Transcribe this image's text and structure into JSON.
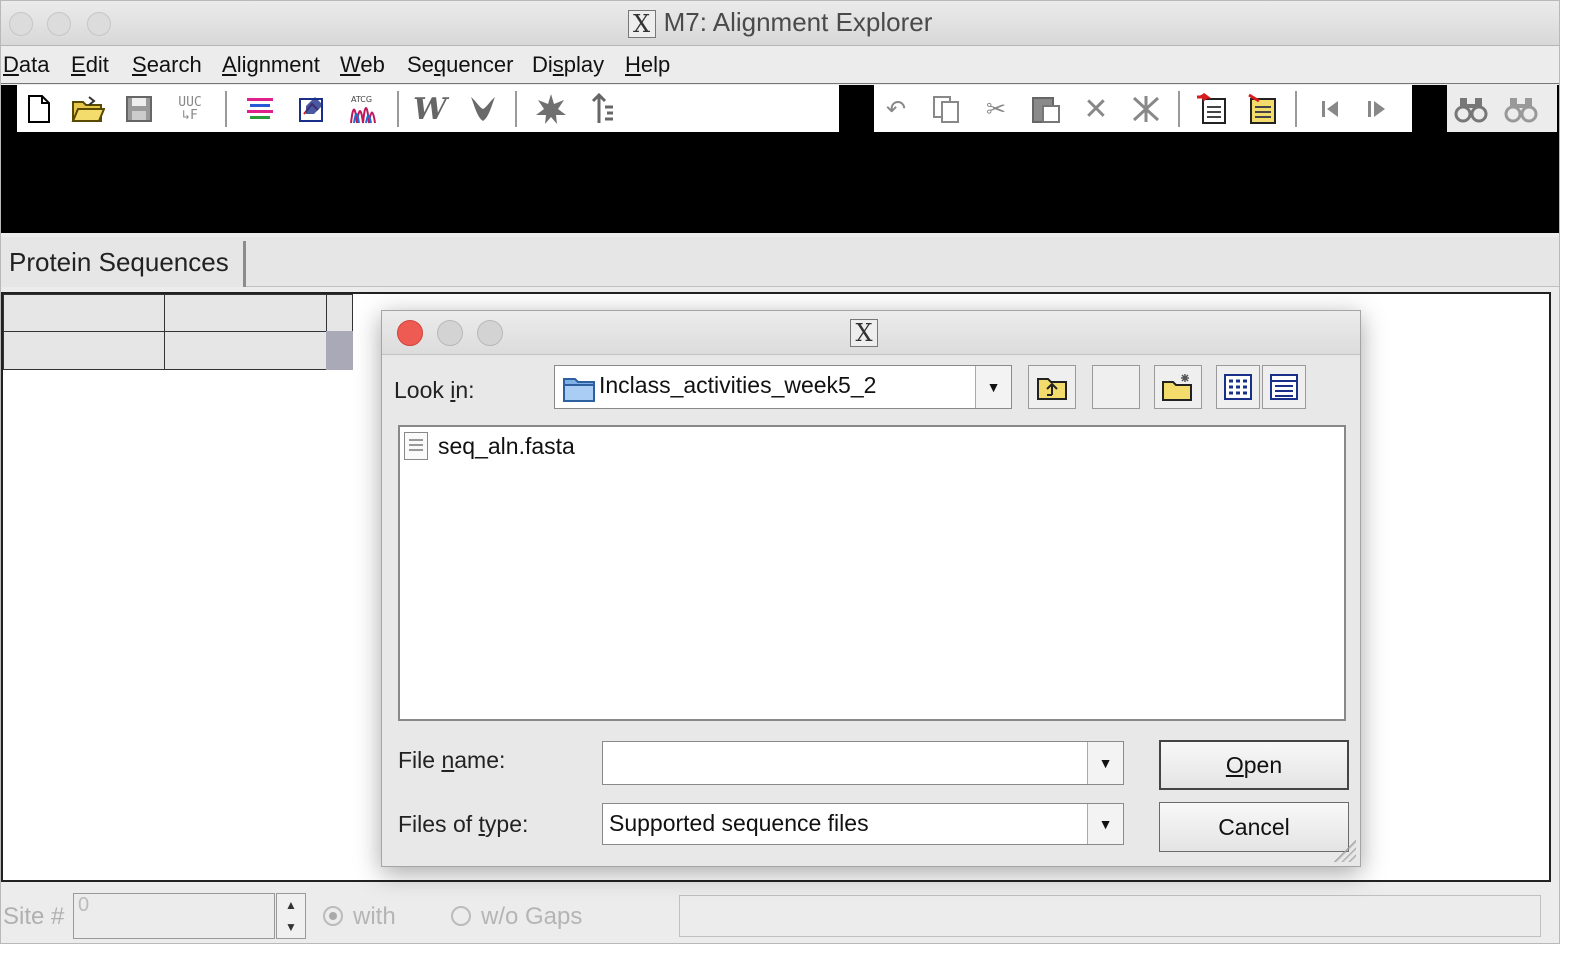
{
  "window": {
    "title": "M7: Alignment Explorer"
  },
  "menu": {
    "items": [
      {
        "pre": "",
        "u": "D",
        "post": "ata"
      },
      {
        "pre": "",
        "u": "E",
        "post": "dit"
      },
      {
        "pre": "",
        "u": "S",
        "post": "earch"
      },
      {
        "pre": "",
        "u": "A",
        "post": "lignment"
      },
      {
        "pre": "",
        "u": "W",
        "post": "eb"
      },
      {
        "pre": "Se",
        "u": "q",
        "post": "uencer"
      },
      {
        "pre": "Di",
        "u": "s",
        "post": "play"
      },
      {
        "pre": "",
        "u": "H",
        "post": "elp"
      }
    ]
  },
  "toolbar": {
    "icons": {
      "new": "new-document-icon",
      "open": "open-folder-icon",
      "save": "save-disk-icon",
      "translate": "translate-codons-icon",
      "align_clustal": "color-lines-icon",
      "edit_seq": "edit-sequence-icon",
      "sequencer": "trace-file-icon",
      "clustal_w": "clustalw-icon",
      "muscle": "muscle-icon",
      "star": "burst-icon",
      "mark": "mark-site-icon"
    },
    "edit_icons": [
      "undo-icon",
      "copy-icon",
      "cut-icon",
      "paste-icon",
      "delete-icon",
      "delete-gap-icon"
    ],
    "insert_icons": [
      "insert-sequence-icon",
      "insert-blank-icon"
    ],
    "nav_icons": [
      "previous-icon",
      "next-icon"
    ],
    "find_icons": [
      "find-icon",
      "find-next-icon"
    ]
  },
  "tabs": {
    "active": "Protein Sequences"
  },
  "statusbar": {
    "site_label": "Site #",
    "site_value": "0",
    "with_label": "with",
    "without_label": "w/o Gaps"
  },
  "dialog": {
    "look_in_pre": "Look ",
    "look_in_u": "i",
    "look_in_post": "n:",
    "folder": "Inclass_activities_week5_2",
    "files": [
      "seq_aln.fasta"
    ],
    "file_name_pre": "File ",
    "file_name_u": "n",
    "file_name_post": "ame:",
    "file_name_value": "",
    "files_type_pre": "Files of ",
    "files_type_u": "t",
    "files_type_post": "ype:",
    "files_type_value": "Supported sequence files",
    "open_u": "O",
    "open_post": "pen",
    "cancel_label": "Cancel"
  },
  "colors": {
    "close_light": "#ee5b52",
    "min_light": "#d3d3d3",
    "max_light": "#d3d3d3"
  }
}
